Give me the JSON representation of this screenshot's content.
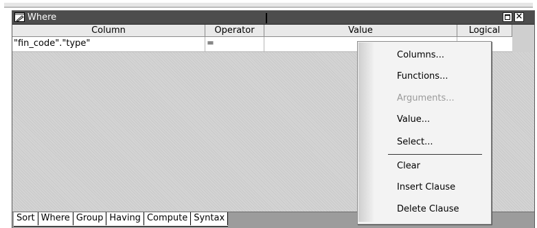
{
  "window": {
    "title": "Where"
  },
  "grid": {
    "headers": [
      "Column",
      "Operator",
      "Value",
      "Logical"
    ],
    "rows": [
      {
        "column": "\"fin_code\".\"type\"",
        "operator": "=",
        "value": "",
        "logical": ""
      }
    ]
  },
  "tabs": [
    "Sort",
    "Where",
    "Group",
    "Having",
    "Compute",
    "Syntax"
  ],
  "active_tab": "Where",
  "context_menu": {
    "items": [
      {
        "label": "Columns...",
        "enabled": true
      },
      {
        "label": "Functions...",
        "enabled": true
      },
      {
        "label": "Arguments...",
        "enabled": false
      },
      {
        "label": "Value...",
        "enabled": true
      },
      {
        "label": "Select...",
        "enabled": true
      },
      {
        "label": "Clear",
        "enabled": true
      },
      {
        "label": "Insert Clause",
        "enabled": true
      },
      {
        "label": "Delete Clause",
        "enabled": true
      }
    ]
  },
  "colors": {
    "titlebar": "#4d4d4d",
    "header": "#e9e9e9",
    "menu": "#f3f3f3",
    "tabbar": "#9c9c9c"
  },
  "icons": {
    "title": "pencil-window-icon",
    "maximize": "maximize-icon",
    "close": "close-icon"
  }
}
